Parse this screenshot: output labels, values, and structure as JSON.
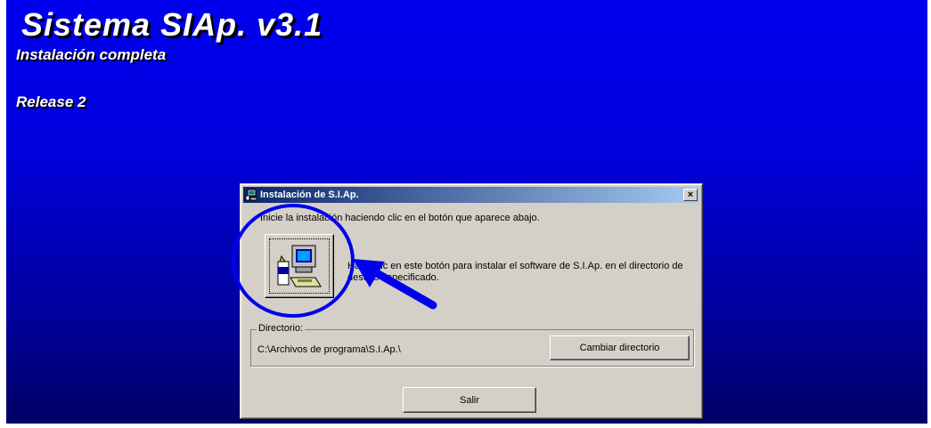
{
  "desktop": {
    "title": "Sistema SIAp. v3.1",
    "subtitle": "Instalación completa",
    "release": "Release 2",
    "background_color": "#0000ee"
  },
  "dialog": {
    "title": "Instalación de S.I.Ap.",
    "close_label": "×",
    "instruction": "Inicie la instalación haciendo clic en el botón que aparece abajo.",
    "install_description": "Haga clic en este botón para instalar el software de S.I.Ap. en el directorio de destino especificado.",
    "install_icon": "computer-install-icon",
    "directory": {
      "legend": "Directorio:",
      "path": "C:\\Archivos de programa\\S.I.Ap.\\",
      "change_button": "Cambiar directorio"
    },
    "exit_button": "Salir"
  },
  "annotations": {
    "highlight_circle_color": "#0000ee",
    "arrow_color": "#0000ee"
  }
}
